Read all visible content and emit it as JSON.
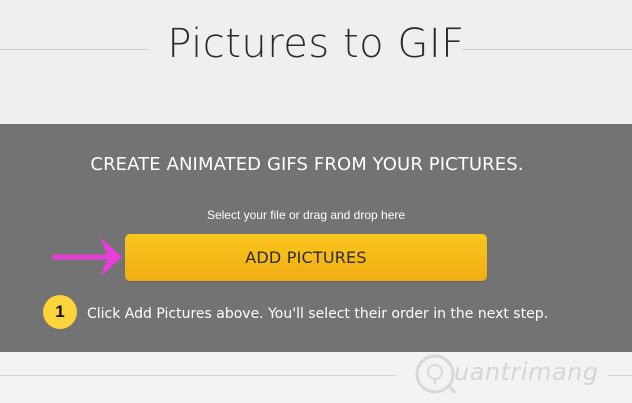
{
  "header": {
    "title": "Pictures to GIF"
  },
  "panel": {
    "heading": "CREATE ANIMATED GIFS FROM YOUR PICTURES.",
    "helper_text": "Select your file or drag and drop here",
    "button_label": "ADD PICTURES",
    "step_number": "1",
    "step_text": "Click Add Pictures above. You'll select their order in the next step."
  },
  "watermark": {
    "text": "uantrimang"
  },
  "colors": {
    "panel_bg": "#737373",
    "button": "#f5b818",
    "badge": "#fcd33b",
    "arrow": "#e63ed6"
  }
}
